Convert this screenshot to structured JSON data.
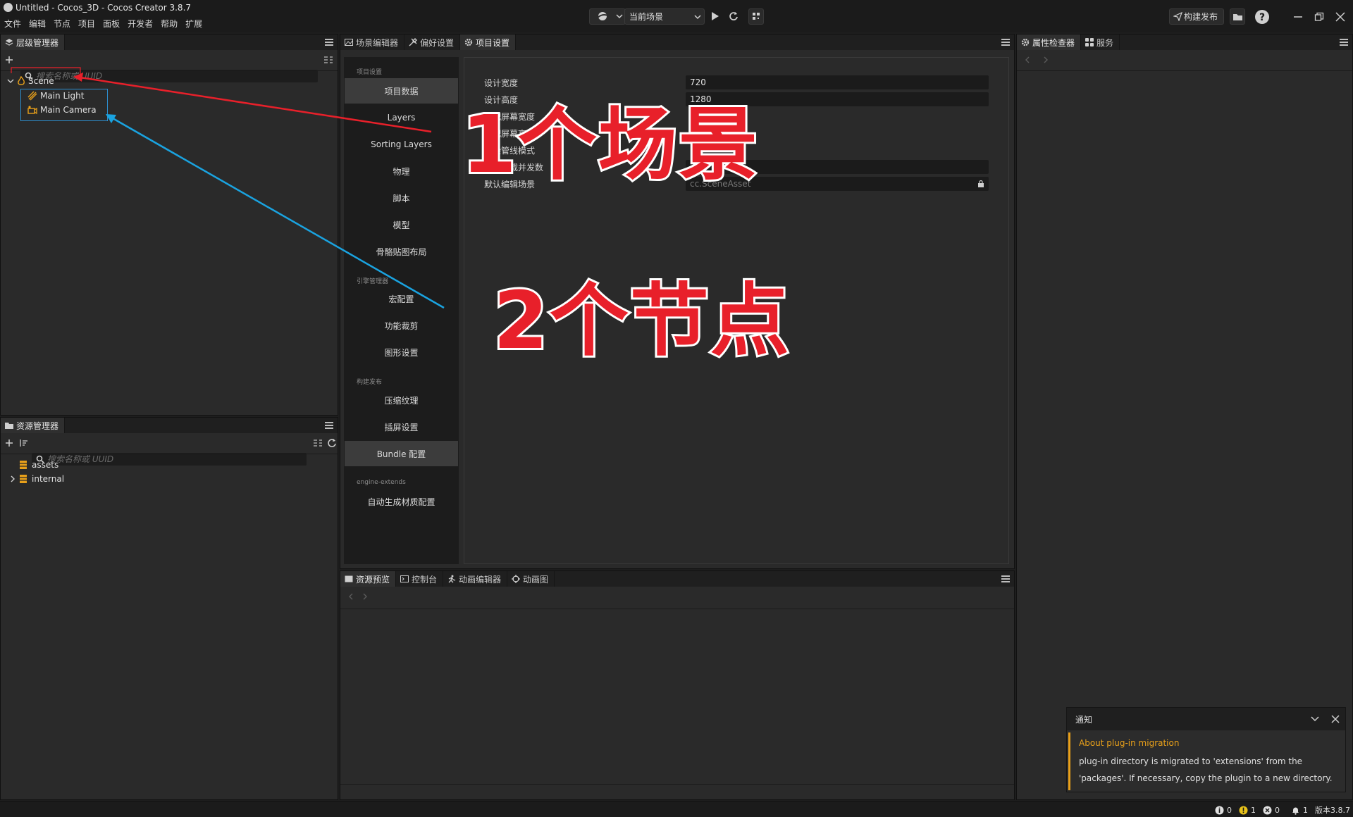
{
  "window": {
    "title": "Untitled - Cocos_3D - Cocos Creator 3.8.7"
  },
  "menu": [
    "文件",
    "编辑",
    "节点",
    "项目",
    "面板",
    "开发者",
    "帮助",
    "扩展"
  ],
  "toolbar": {
    "scene_select": "当前场景",
    "build_publish": "构建发布"
  },
  "hierarchy": {
    "tab": "层级管理器",
    "search_placeholder": "搜索名称或 UUID",
    "nodes": [
      {
        "label": "Scene"
      },
      {
        "label": "Main Light"
      },
      {
        "label": "Main Camera"
      }
    ]
  },
  "assets": {
    "tab": "资源管理器",
    "search_placeholder": "搜索名称或 UUID",
    "items": [
      {
        "label": "assets"
      },
      {
        "label": "internal"
      }
    ]
  },
  "center_tabs": [
    "场景编辑器",
    "偏好设置",
    "项目设置"
  ],
  "settings": {
    "nav": {
      "cat_project": "项目设置",
      "items_project": [
        "项目数据",
        "Layers",
        "Sorting Layers",
        "物理",
        "脚本",
        "模型",
        "骨骼贴图布局"
      ],
      "cat_engine": "引擎管理器",
      "items_engine": [
        "宏配置",
        "功能裁剪",
        "图形设置"
      ],
      "cat_build": "构建发布",
      "items_build": [
        "压缩纹理",
        "插屏设置",
        "Bundle 配置"
      ],
      "cat_ext": "engine-extends",
      "items_ext": [
        "自动生成材质配置"
      ]
    },
    "fields": {
      "design_width_label": "设计宽度",
      "design_width": "720",
      "design_height_label": "设计高度",
      "design_height": "1280",
      "fit_width_label": "适配屏幕宽度",
      "fit_height_label": "适配屏幕高度",
      "render_pipeline_label": "渲染管线模式",
      "download_label": "资源下载并发数",
      "default_scene_label": "默认编辑场景",
      "default_scene_value": "cc.SceneAsset"
    }
  },
  "bottom_tabs": [
    "资源预览",
    "控制台",
    "动画编辑器",
    "动画图"
  ],
  "inspector_tabs": [
    "属性检查器",
    "服务"
  ],
  "notification": {
    "header": "通知",
    "title": "About plug-in migration",
    "body": "plug-in directory is migrated to 'extensions' from the 'packages'. If necessary, copy the plugin to a new directory."
  },
  "annotations": {
    "text1": "1个场景",
    "text2": "2个节点"
  },
  "status": {
    "info": "0",
    "warn": "1",
    "error": "0",
    "bell": "1",
    "version": "版本3.8.7"
  },
  "colors": {
    "accent_orange": "#e8a01a",
    "annotation_red": "#e8202a",
    "arrow_blue": "#1aa3e0",
    "selection_blue": "#2d8fd0"
  }
}
